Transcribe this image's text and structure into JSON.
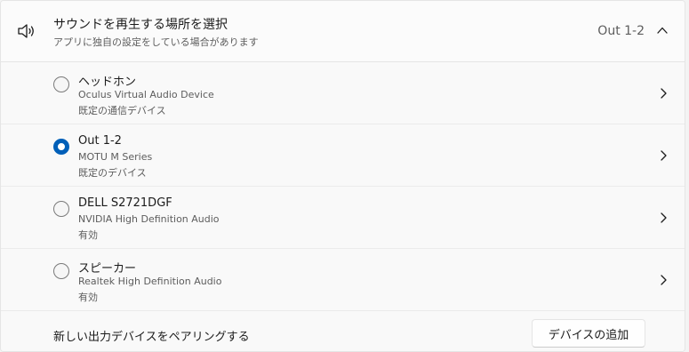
{
  "header": {
    "title": "サウンドを再生する場所を選択",
    "subtitle": "アプリに独自の設定をしている場合があります",
    "current_value": "Out 1-2",
    "icon": "speaker-icon",
    "expand_icon": "chevron-up-icon"
  },
  "devices": [
    {
      "name": "ヘッドホン",
      "driver": "Oculus Virtual Audio Device",
      "status": "既定の通信デバイス",
      "selected": false
    },
    {
      "name": "Out 1-2",
      "driver": "MOTU M Series",
      "status": "既定のデバイス",
      "selected": true
    },
    {
      "name": "DELL S2721DGF",
      "driver": "NVIDIA High Definition Audio",
      "status": "有効",
      "selected": false
    },
    {
      "name": "スピーカー",
      "driver": "Realtek High Definition Audio",
      "status": "有効",
      "selected": false
    }
  ],
  "footer": {
    "label": "新しい出力デバイスをペアリングする",
    "button_label": "デバイスの追加"
  },
  "colors": {
    "accent": "#005fb8",
    "background": "#f9f9f9",
    "border": "#e5e5e5",
    "secondary_text": "#5d5d5d"
  }
}
